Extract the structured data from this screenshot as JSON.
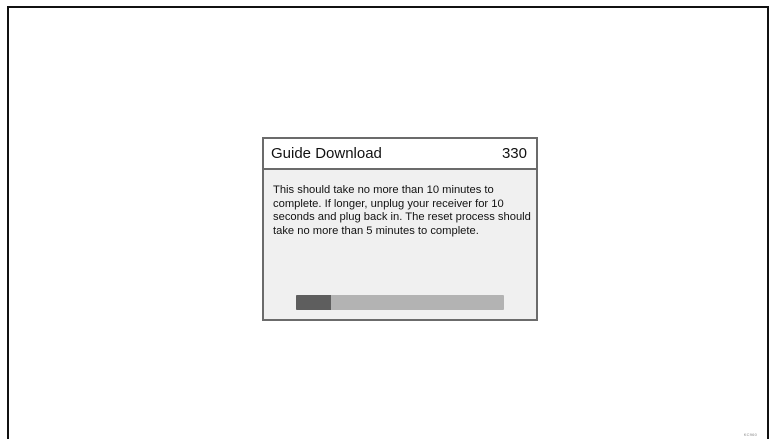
{
  "dialog": {
    "title": "Guide Download",
    "code": "330",
    "message": "This should take no more than 10 minutes to complete. If longer, unplug your receiver for 10 seconds and plug back in. The reset process should take no more than 5 minutes to complete.",
    "progress_fraction": 0.17
  },
  "watermark": "KC960",
  "colors": {
    "dialog_border": "#6b6b6b",
    "dialog_body_bg": "#f0f0f0",
    "progress_track": "#b3b3b3",
    "progress_fill": "#5e5e5e"
  }
}
